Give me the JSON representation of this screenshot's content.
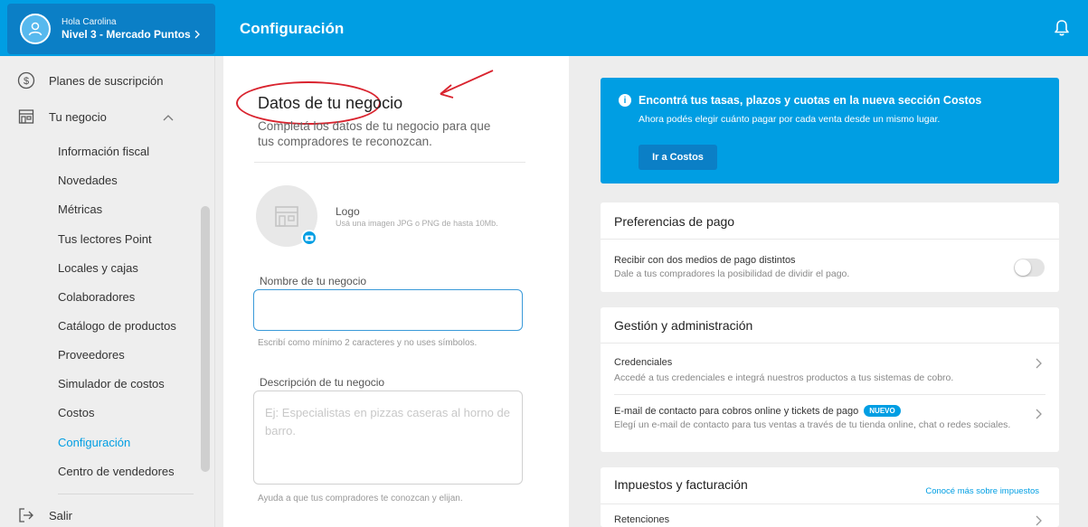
{
  "header": {
    "greeting": "Hola Carolina",
    "level": "Nivel 3 - Mercado Puntos",
    "page_title": "Configuración"
  },
  "sidebar": {
    "items": [
      {
        "label": "Planes de suscripción",
        "icon": "dollar-circle-icon"
      },
      {
        "label": "Tu negocio",
        "icon": "store-icon"
      }
    ],
    "subitems": [
      "Información fiscal",
      "Novedades",
      "Métricas",
      "Tus lectores Point",
      "Locales y cajas",
      "Colaboradores",
      "Catálogo de productos",
      "Proveedores",
      "Simulador de costos",
      "Costos",
      "Configuración",
      "Centro de vendedores"
    ],
    "active_subitem": "Configuración",
    "logout_label": "Salir"
  },
  "form": {
    "title": "Datos de tu negocio",
    "subtitle": "Completá los datos de tu negocio para que tus compradores te reconozcan.",
    "logo_label": "Logo",
    "logo_hint": "Usá una imagen JPG o PNG de hasta 10Mb.",
    "name_label": "Nombre de tu negocio",
    "name_value": "",
    "name_hint": "Escribí como mínimo 2 caracteres y no uses símbolos.",
    "desc_label": "Descripción de tu negocio",
    "desc_placeholder": "Ej: Especialistas en pizzas caseras al horno de barro.",
    "desc_hint": "Ayuda a que tus compradores te conozcan y elijan."
  },
  "promo": {
    "title": "Encontrá tus tasas, plazos y cuotas en la nueva sección Costos",
    "subtitle": "Ahora podés elegir cuánto pagar por cada venta desde un mismo lugar.",
    "button": "Ir a Costos"
  },
  "payment_prefs": {
    "title": "Preferencias de pago",
    "row_title": "Recibir con dos medios de pago distintos",
    "row_desc": "Dale a tus compradores la posibilidad de dividir el pago.",
    "toggle_on": false
  },
  "management": {
    "title": "Gestión y administración",
    "rows": [
      {
        "title": "Credenciales",
        "desc": "Accedé a tus credenciales e integrá nuestros productos a tus sistemas de cobro."
      },
      {
        "title": "E-mail de contacto para cobros online y tickets de pago",
        "badge": "NUEVO",
        "desc": "Elegí un e-mail de contacto para tus ventas a través de tu tienda online, chat o redes sociales."
      }
    ]
  },
  "taxes": {
    "title": "Impuestos y facturación",
    "link": "Conocé más sobre impuestos",
    "row_title": "Retenciones"
  },
  "colors": {
    "brand_blue": "#009ee3",
    "dark_blue": "#0b7fc6",
    "annotation_red": "#d9232e"
  }
}
